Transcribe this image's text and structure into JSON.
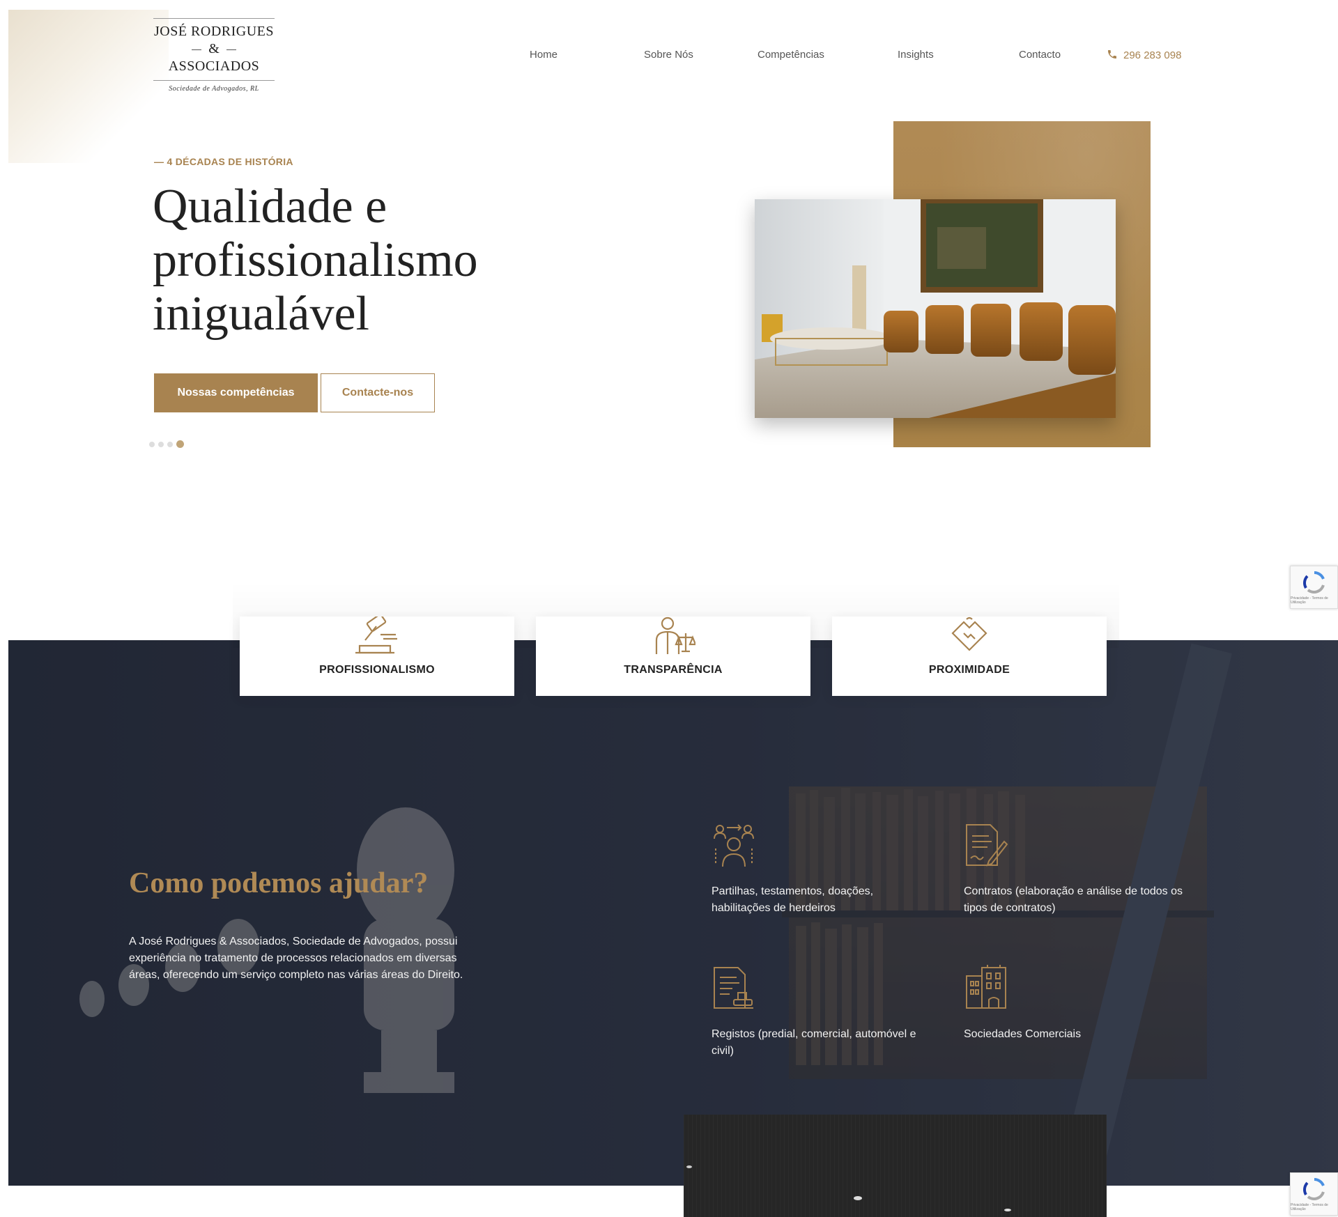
{
  "brand": {
    "line1": "JOSÉ RODRIGUES",
    "line2": "&",
    "line3": "ASSOCIADOS",
    "tagline": "Sociedade de Advogados, RL"
  },
  "nav": {
    "items": [
      {
        "label": "Home"
      },
      {
        "label": "Sobre Nós"
      },
      {
        "label": "Competências"
      },
      {
        "label": "Insights"
      },
      {
        "label": "Contacto"
      }
    ],
    "phone": "296 283 098"
  },
  "hero": {
    "eyebrow": "— 4 DÉCADAS DE HISTÓRIA",
    "title_line1": "Qualidade e",
    "title_line2": "profissionalismo",
    "title_line3": "inigualável",
    "primary_button": "Nossas competências",
    "secondary_button": "Contacte-nos",
    "slider_count": 4,
    "slider_active": 4
  },
  "values": [
    {
      "label": "PROFISSIONALISMO",
      "icon": "gavel-icon"
    },
    {
      "label": "TRANSPARÊNCIA",
      "icon": "lawyer-scales-icon"
    },
    {
      "label": "PROXIMIDADE",
      "icon": "handshake-icon"
    }
  ],
  "help": {
    "title": "Como podemos ajudar?",
    "text": "A José Rodrigues & Associados, Sociedade de Advogados, possui experiência no tratamento de processos relacionados em diversas áreas, oferecendo um serviço completo nas várias áreas do Direito.",
    "services": [
      {
        "label": "Partilhas, testamentos, doações, habilitações de herdeiros",
        "icon": "inheritance-icon"
      },
      {
        "label": "Contratos (elaboração e análise de todos os tipos de contratos)",
        "icon": "contract-icon"
      },
      {
        "label": "Registos (predial, comercial, automóvel e civil)",
        "icon": "registry-stamp-icon"
      },
      {
        "label": "Sociedades Comerciais",
        "icon": "buildings-icon"
      }
    ]
  },
  "recaptcha": {
    "text": "Privacidade - Termos de Utilização"
  },
  "colors": {
    "accent": "#a88350",
    "dark": "#262b3a",
    "title_gold": "#b08a55"
  }
}
